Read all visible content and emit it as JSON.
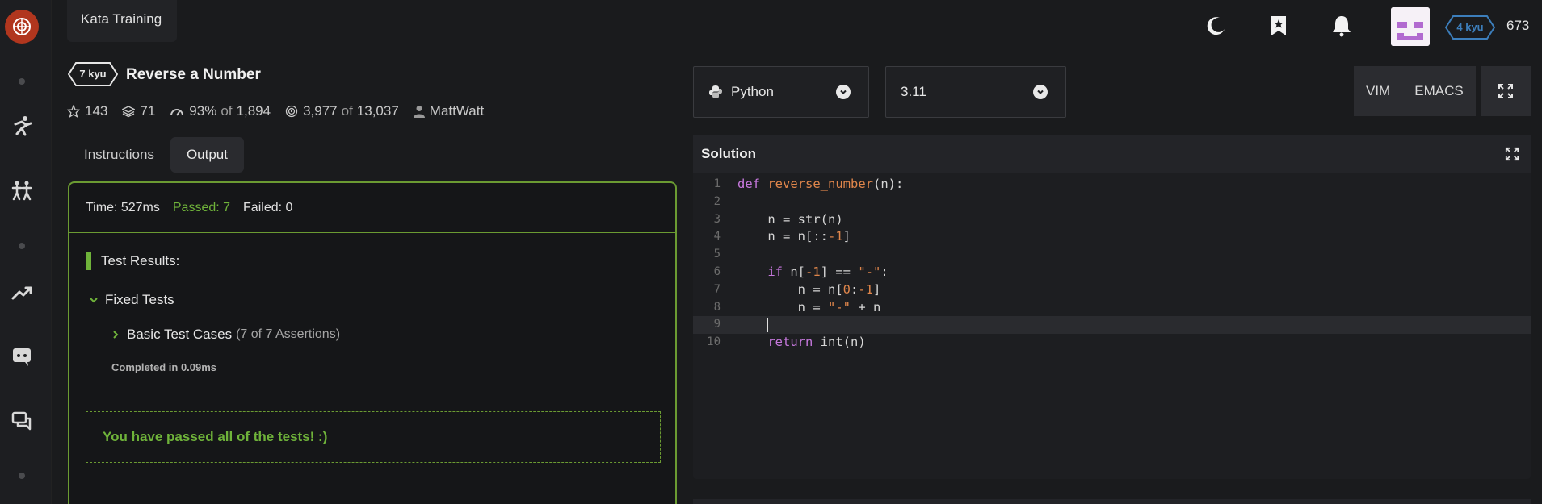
{
  "topbar": {
    "tab_label": "Kata Training",
    "rank": "4 kyu",
    "honor": "673"
  },
  "kata": {
    "kyu": "7 kyu",
    "title": "Reverse a Number",
    "stars": "143",
    "collections": "71",
    "satisfaction_pct": "93%",
    "satisfaction_of": "of",
    "satisfaction_total": "1,894",
    "completed": "3,977",
    "completed_of": "of",
    "attempted": "13,037",
    "author": "MattWatt"
  },
  "tabs": [
    {
      "label": "Instructions",
      "active": false
    },
    {
      "label": "Output",
      "active": true
    }
  ],
  "output": {
    "time": "Time: 527ms",
    "passed": "Passed: 7",
    "failed": "Failed: 0",
    "results_label": "Test Results:",
    "group": "Fixed Tests",
    "case": "Basic Test Cases",
    "case_assertions": "(7 of 7 Assertions)",
    "completed_in": "Completed in 0.09ms",
    "pass_message": "You have passed all of the tests! :)"
  },
  "editor": {
    "language": "Python",
    "version": "3.11",
    "modes": [
      "VIM",
      "EMACS"
    ],
    "panel_title": "Solution",
    "line_numbers": [
      "1",
      "2",
      "3",
      "4",
      "5",
      "6",
      "7",
      "8",
      "9",
      "10"
    ]
  },
  "colors": {
    "accent_green": "#6fb33a",
    "logo_red": "#b1361e",
    "rank_blue": "#3c7ebb"
  },
  "icons": {
    "sidebar": [
      "codewars-logo-icon",
      "training-icon",
      "practice-icon",
      "leaderboard-icon",
      "discord-icon",
      "chat-icon"
    ],
    "topbar": [
      "moon-icon",
      "bookmark-icon",
      "bell-icon"
    ]
  }
}
